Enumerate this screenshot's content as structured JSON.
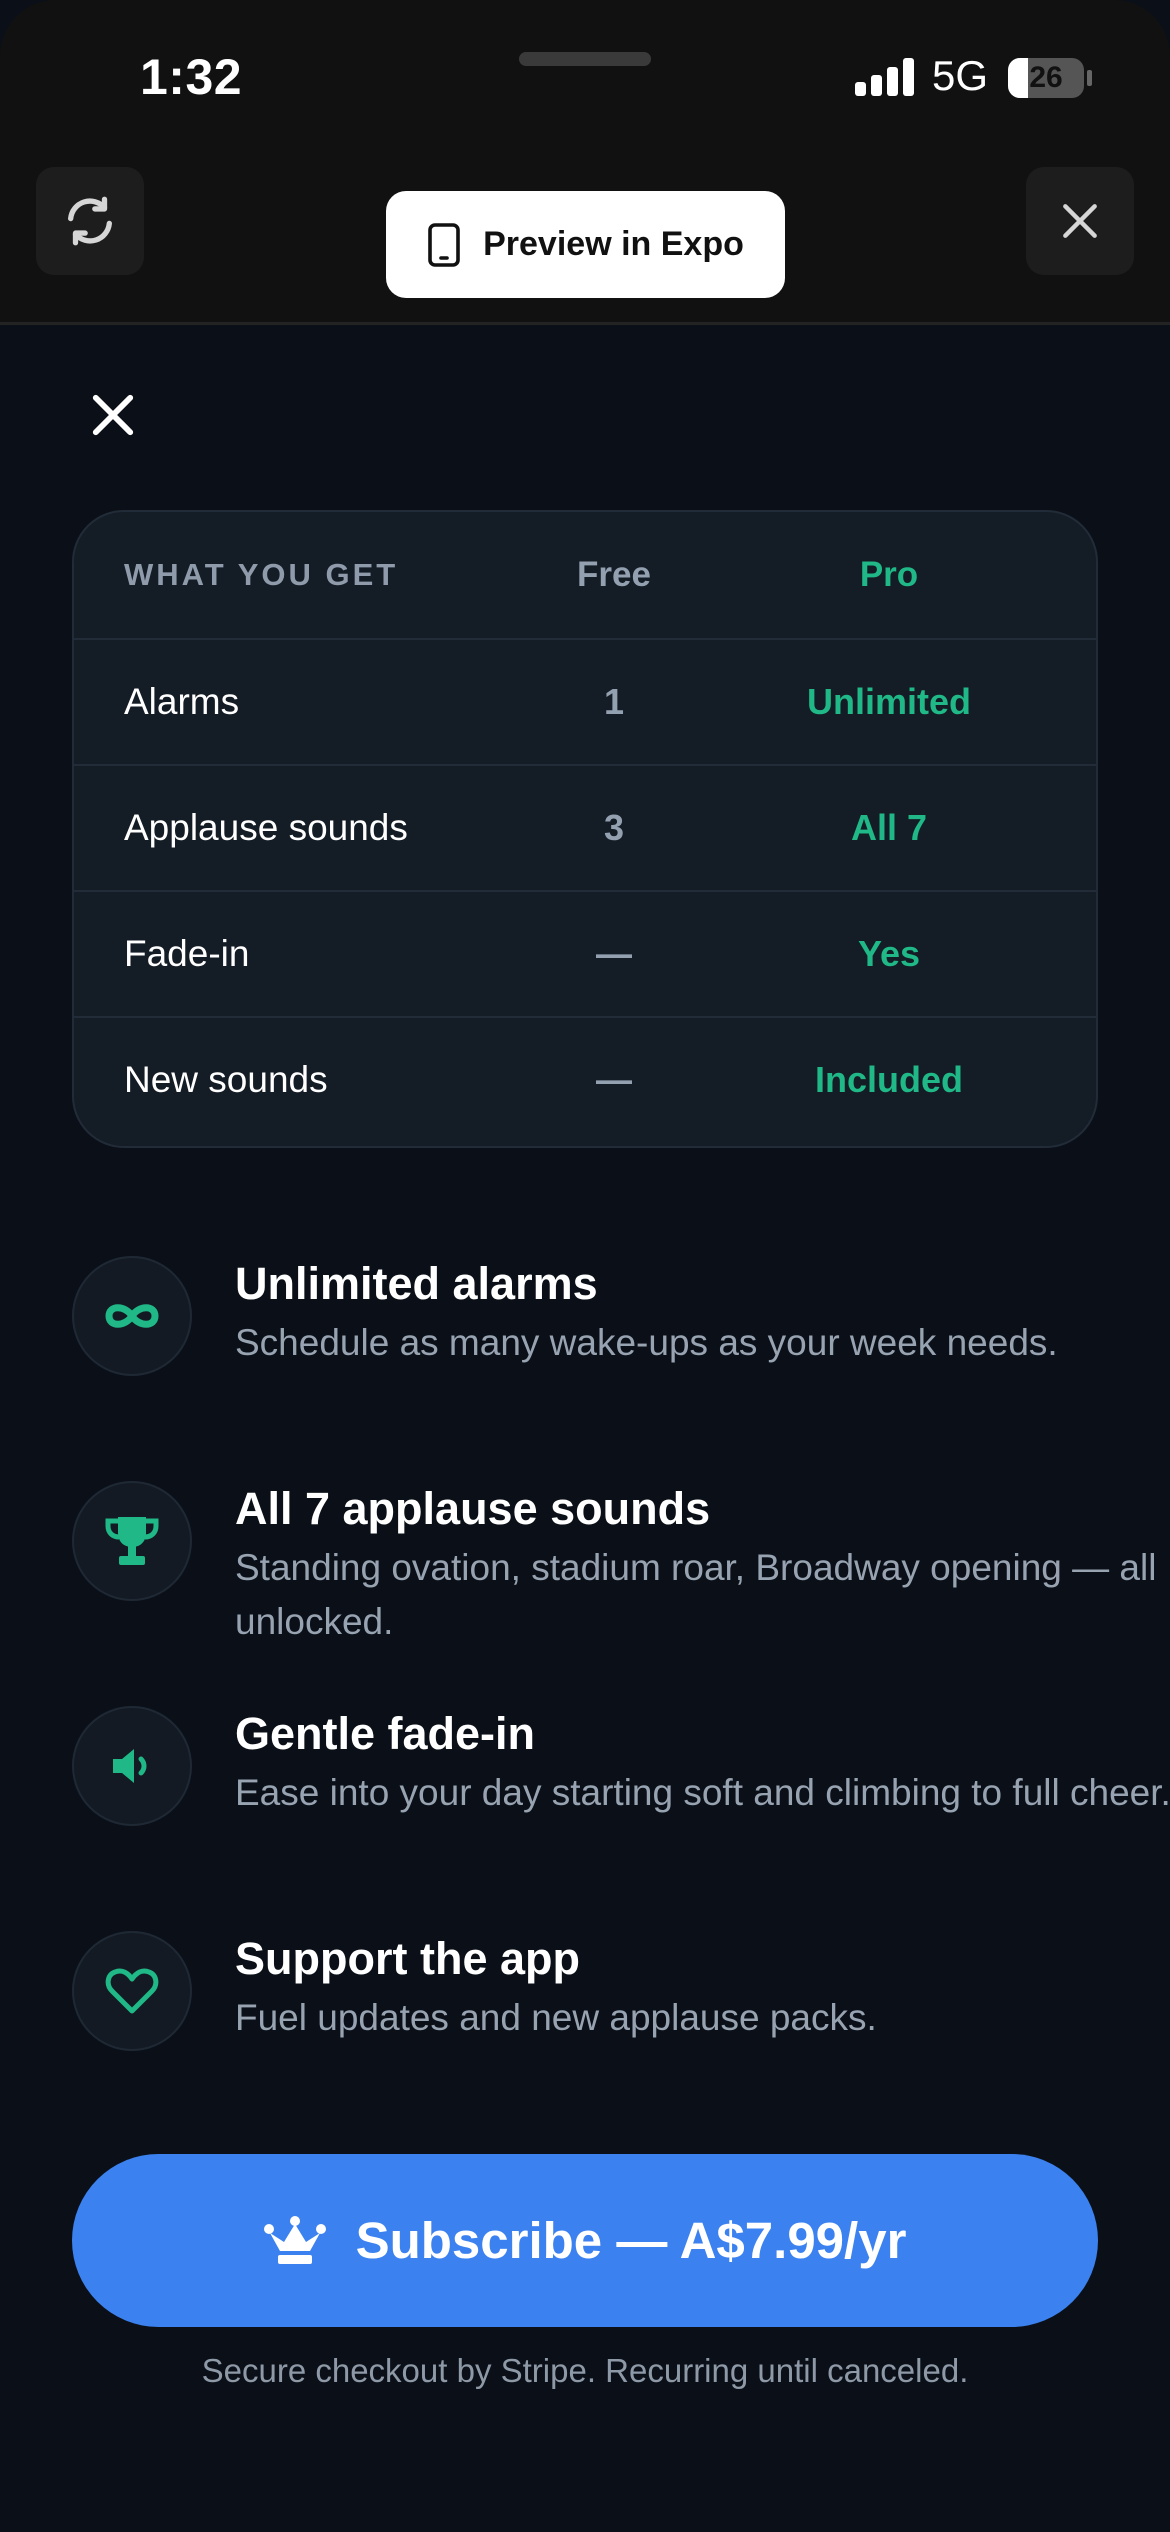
{
  "status_bar": {
    "time": "1:32",
    "network": "5G",
    "battery_level": "26",
    "battery_fraction": 0.26,
    "signal_bars": 4
  },
  "expo_bar": {
    "preview_label": "Preview in Expo",
    "reload_icon": "reload-icon",
    "close_icon": "close-icon",
    "phone_icon": "phone-icon"
  },
  "comparison": {
    "header": {
      "label": "WHAT YOU GET",
      "free": "Free",
      "pro": "Pro"
    },
    "rows": [
      {
        "label": "Alarms",
        "free": "1",
        "pro": "Unlimited"
      },
      {
        "label": "Applause sounds",
        "free": "3",
        "pro": "All 7"
      },
      {
        "label": "Fade-in",
        "free": "—",
        "pro": "Yes"
      },
      {
        "label": "New sounds",
        "free": "—",
        "pro": "Included"
      }
    ]
  },
  "features": [
    {
      "icon": "infinity-icon",
      "title": "Unlimited alarms",
      "desc": "Schedule as many wake-ups as your week needs."
    },
    {
      "icon": "trophy-icon",
      "title": "All 7 applause sounds",
      "desc": "Standing ovation, stadium roar, Broadway opening — all unlocked."
    },
    {
      "icon": "speaker-icon",
      "title": "Gentle fade-in",
      "desc": "Ease into your day starting soft and climbing to full cheer."
    },
    {
      "icon": "heart-icon",
      "title": "Support the app",
      "desc": "Fuel updates and new applause packs."
    }
  ],
  "cta": {
    "icon": "crown-icon",
    "label": "Subscribe — A$7.99/yr",
    "fineprint": "Secure checkout by Stripe. Recurring until canceled."
  },
  "colors": {
    "accent_green": "#1fb886",
    "cta_blue": "#3b82f0",
    "background": "#0b1018"
  }
}
